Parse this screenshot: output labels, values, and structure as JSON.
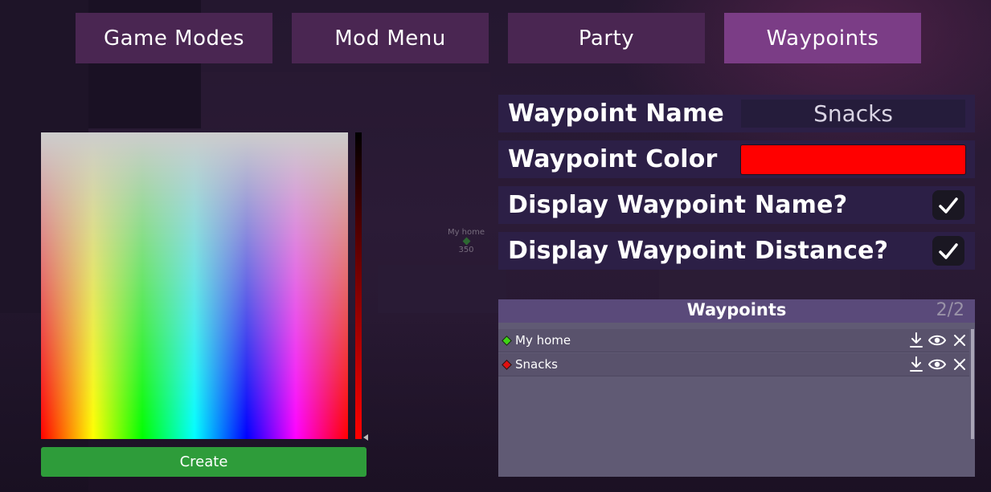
{
  "tabs": [
    {
      "label": "Game Modes",
      "active": false
    },
    {
      "label": "Mod Menu",
      "active": false
    },
    {
      "label": "Party",
      "active": false
    },
    {
      "label": "Waypoints",
      "active": true
    }
  ],
  "world_marker": {
    "name": "My home",
    "distance": "350"
  },
  "picker": {
    "create_label": "Create",
    "selected_color": "#ff0000"
  },
  "settings": {
    "name_label": "Waypoint Name",
    "name_value": "Snacks",
    "color_label": "Waypoint Color",
    "color_value": "#ff0000",
    "display_name_label": "Display Waypoint Name?",
    "display_name_checked": true,
    "display_distance_label": "Display Waypoint Distance?",
    "display_distance_checked": true
  },
  "waypoints": {
    "title": "Waypoints",
    "count": "2/2",
    "items": [
      {
        "name": "My home",
        "color": "#3fd414",
        "icons": [
          "download-icon",
          "eye-icon",
          "close-icon"
        ]
      },
      {
        "name": "Snacks",
        "color": "#e01010",
        "icons": [
          "download-icon",
          "eye-icon",
          "close-icon"
        ]
      }
    ]
  }
}
